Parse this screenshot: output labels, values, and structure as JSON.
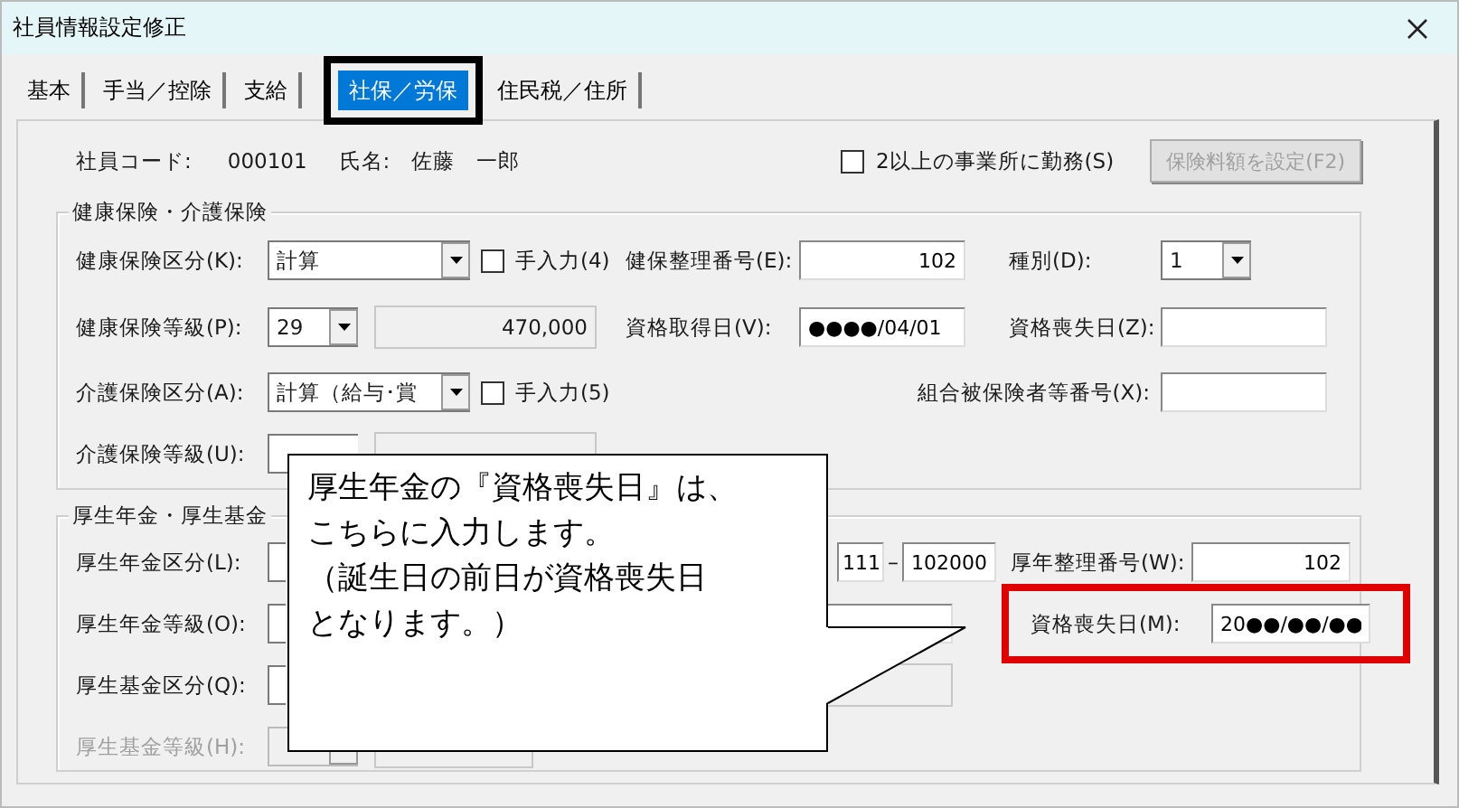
{
  "window": {
    "title": "社員情報設定修正"
  },
  "tabs": [
    {
      "label": "基本",
      "selected": false
    },
    {
      "label": "手当／控除",
      "selected": false
    },
    {
      "label": "支給",
      "selected": false
    },
    {
      "label": "社保／労保",
      "selected": true
    },
    {
      "label": "住民税／住所",
      "selected": false
    }
  ],
  "employee": {
    "code_label": "社員コード:",
    "code": "000101",
    "name_label": "氏名:",
    "name": "佐藤　一郎"
  },
  "multi_office": {
    "label": "2以上の事業所に勤務(S)",
    "checked": false
  },
  "fee_button": {
    "label": "保険料額を設定(F2)",
    "disabled": true
  },
  "health": {
    "title": "健康保険・介護保険",
    "health_class": {
      "label": "健康保険区分(K):",
      "value": "計算"
    },
    "health_manual": {
      "label": "手入力(4)",
      "checked": false
    },
    "health_ref_no": {
      "label": "健保整理番号(E):",
      "value": "102"
    },
    "type": {
      "label": "種別(D):",
      "value": "1"
    },
    "health_grade": {
      "label": "健康保険等級(P):",
      "value": "29",
      "amount": "470,000"
    },
    "acquired": {
      "label": "資格取得日(V):",
      "value": "●●●●/04/01"
    },
    "lost": {
      "label": "資格喪失日(Z):"
    },
    "care_class": {
      "label": "介護保険区分(A):",
      "value": "計算（給与･賞"
    },
    "care_manual": {
      "label": "手入力(5)",
      "checked": false
    },
    "union_no": {
      "label": "組合被保険者等番号(X):"
    },
    "care_grade": {
      "label": "介護保険等級(U):"
    }
  },
  "pension": {
    "title": "厚生年金・厚生基金",
    "pension_class": {
      "label": "厚生年金区分(L):"
    },
    "office_no": {
      "part_1": "111",
      "separator": "–",
      "part_2": "102000"
    },
    "pension_ref_no": {
      "label": "厚年整理番号(W):",
      "value": "102"
    },
    "pension_grade": {
      "label": "厚生年金等級(O):"
    },
    "lost": {
      "label": "資格喪失日(M):",
      "value": "20●●/●●/●●",
      "highlighted": true
    },
    "fund_class": {
      "label": "厚生基金区分(Q):"
    },
    "fund_grade": {
      "label": "厚生基金等級(H):",
      "disabled": true
    }
  },
  "callout": {
    "lines": [
      "厚生年金の『資格喪失日』は、",
      "こちらに入力します。",
      "（誕生日の前日が資格喪失日",
      "となります。）"
    ]
  }
}
